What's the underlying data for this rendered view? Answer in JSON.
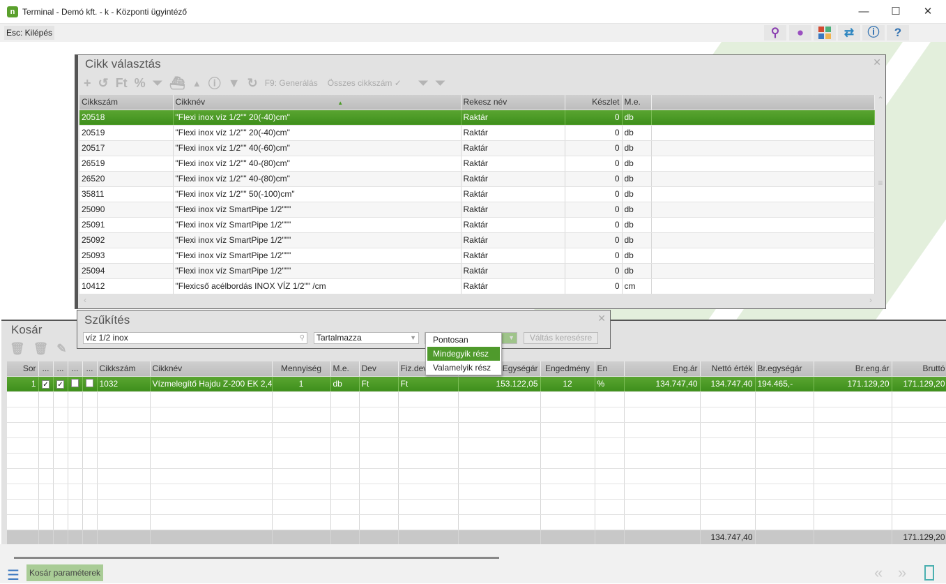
{
  "window": {
    "title": "Terminal - Demó kft. - k - Központi ügyintéző",
    "icon_letter": "n",
    "minimize": "—",
    "maximize": "☐",
    "close": "✕"
  },
  "toolbar": {
    "esc_label": "Esc: Kilépés",
    "icons": [
      "search-icon",
      "user-icon",
      "apps-icon",
      "swap-icon",
      "info-icon",
      "help-icon"
    ]
  },
  "cikk": {
    "title": "Cikk választás",
    "tools": {
      "add": "+",
      "undo": "↺",
      "ft": "Ft",
      "percent": "%",
      "up": "▲",
      "info": "ⓘ",
      "filter": "▼",
      "refresh": "↻",
      "generate": "F9: Generálás",
      "all": "Összes cikkszám ✓"
    },
    "columns": [
      "Cikkszám",
      "Cikknév",
      "Rekesz név",
      "Készlet",
      "M.e."
    ],
    "rows": [
      [
        "20518",
        "\"Flexi inox víz 1/2\"\" 20(-40)cm\"",
        "Raktár",
        "0",
        "db"
      ],
      [
        "20519",
        "\"Flexi inox víz 1/2\"\" 20(-40)cm\"",
        "Raktár",
        "0",
        "db"
      ],
      [
        "20517",
        "\"Flexi inox víz 1/2\"\" 40(-60)cm\"",
        "Raktár",
        "0",
        "db"
      ],
      [
        "26519",
        "\"Flexi inox víz 1/2\"\" 40-(80)cm\"",
        "Raktár",
        "0",
        "db"
      ],
      [
        "26520",
        "\"Flexi inox víz 1/2\"\" 40-(80)cm\"",
        "Raktár",
        "0",
        "db"
      ],
      [
        "35811",
        "\"Flexi inox víz 1/2\"\" 50(-100)cm\"",
        "Raktár",
        "0",
        "db"
      ],
      [
        "25090",
        "\"Flexi inox víz SmartPipe 1/2\"\"\"",
        "Raktár",
        "0",
        "db"
      ],
      [
        "25091",
        "\"Flexi inox víz SmartPipe 1/2\"\"\"",
        "Raktár",
        "0",
        "db"
      ],
      [
        "25092",
        "\"Flexi inox víz SmartPipe 1/2\"\"\"",
        "Raktár",
        "0",
        "db"
      ],
      [
        "25093",
        "\"Flexi inox víz SmartPipe 1/2\"\"\"",
        "Raktár",
        "0",
        "db"
      ],
      [
        "25094",
        "\"Flexi inox víz SmartPipe 1/2\"\"\"",
        "Raktár",
        "0",
        "db"
      ],
      [
        "10412",
        "\"Flexicső acélbordás INOX VÍZ  1/2\"\" /cm",
        "Raktár",
        "0",
        "cm"
      ]
    ]
  },
  "szukites": {
    "title": "Szűkítés",
    "search_value": "víz 1/2 inox",
    "mode": "Tartalmazza",
    "switch_label": "Váltás keresésre",
    "options": [
      "Pontosan",
      "Mindegyik rész",
      "Valamelyik rész"
    ],
    "selected_option": "Mindegyik rész"
  },
  "kosar": {
    "title": "Kosár",
    "columns": [
      "Sor",
      "...",
      "...",
      "...",
      "...",
      "Cikkszám",
      "Cikknév",
      "Mennyiség",
      "M.e.",
      "Dev",
      "Fiz.dev",
      "Egységár",
      "Engedmény",
      "En",
      "Eng.ár",
      "Nettó érték",
      "Br.egységár",
      "Br.eng.ár",
      "Bruttó"
    ],
    "rows": [
      [
        "1",
        "✓",
        "✓",
        "",
        "",
        "1032",
        "Vízmelegítő Hajdu Z-200 EK 2,4",
        "1",
        "db",
        "Ft",
        "Ft",
        "153.122,05",
        "12",
        "%",
        "134.747,40",
        "134.747,40",
        "194.465,-",
        "171.129,20",
        "171.129,20"
      ]
    ],
    "totals": {
      "netto": "134.747,40",
      "brutto": "171.129,20"
    }
  },
  "bottom": {
    "params_label": "Kosár paraméterek"
  },
  "colors": {
    "accent": "#4f9a2c",
    "selected_row": "#4a9a26"
  }
}
